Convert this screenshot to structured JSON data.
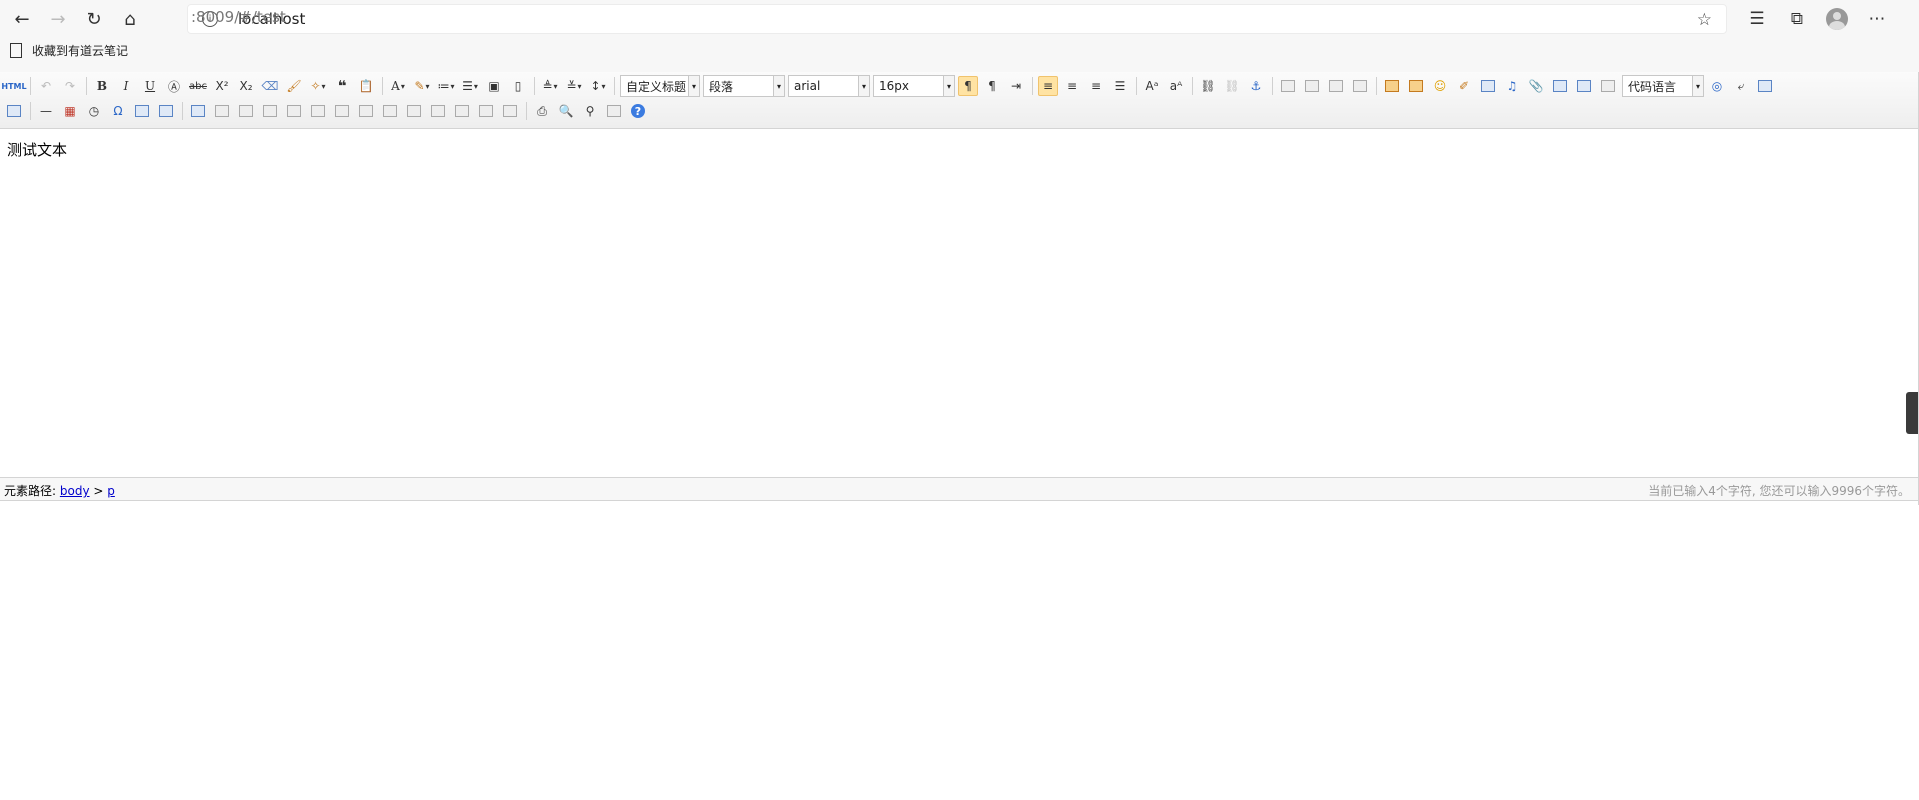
{
  "browser": {
    "url_host": "localhost",
    "url_path": ":8009/#/test",
    "bookmark": "收藏到有道云笔记"
  },
  "toolbar": {
    "source_label": "HTML",
    "heading_select": "自定义标题",
    "paragraph_select": "段落",
    "font_family_select": "arial",
    "font_size_select": "16px",
    "code_lang_select": "代码语言"
  },
  "content": {
    "text": "测试文本"
  },
  "status": {
    "path_label": "元素路径:",
    "path_body": "body",
    "path_sep": " > ",
    "path_p": "p",
    "word_count": "当前已输入4个字符, 您还可以输入9996个字符。"
  }
}
